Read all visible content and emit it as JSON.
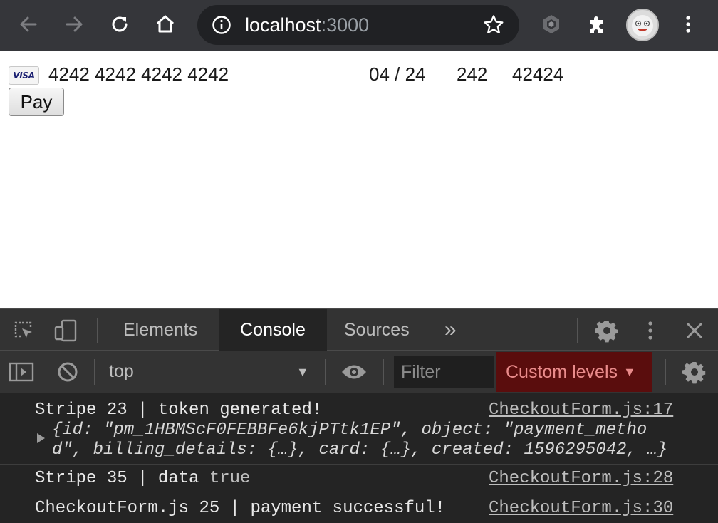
{
  "browser": {
    "url_host": "localhost",
    "url_port": ":3000",
    "icons": {
      "back": "arrow-left-icon",
      "forward": "arrow-right-icon",
      "reload": "reload-icon",
      "home": "home-icon",
      "info": "info-icon",
      "bookmark": "star-icon",
      "extension_1": "hexagon-extension-icon",
      "extensions": "puzzle-icon",
      "menu": "kebab-menu-icon"
    }
  },
  "page": {
    "card_brand": "VISA",
    "card_number": "4242 4242 4242 4242",
    "expiry": "04 / 24",
    "cvc": "242",
    "zip": "42424",
    "pay_label": "Pay"
  },
  "devtools": {
    "tabs": [
      "Elements",
      "Console",
      "Sources"
    ],
    "more_tabs": "»",
    "context": "top",
    "filter_placeholder": "Filter",
    "levels_label": "Custom levels",
    "messages": [
      {
        "text": "Stripe 23 | token generated!",
        "source": "CheckoutForm.js:17",
        "object_line_1": "{id: \"pm_1HBMScF0FEBBFe6kjPTtk1EP\", object: \"payment_metho",
        "object_line_2": "d\", billing_details: {…}, card: {…}, created: 1596295042, …}"
      },
      {
        "text": "Stripe 35 | data",
        "value": "true",
        "source": "CheckoutForm.js:28"
      },
      {
        "text": "CheckoutForm.js 25 | payment successful!",
        "source": "CheckoutForm.js:30"
      }
    ]
  },
  "colors": {
    "toolbar_bg": "#35363a",
    "devtools_bg": "#242424",
    "levels_bg": "#5a0d0d",
    "string_color": "#f29f9a"
  }
}
